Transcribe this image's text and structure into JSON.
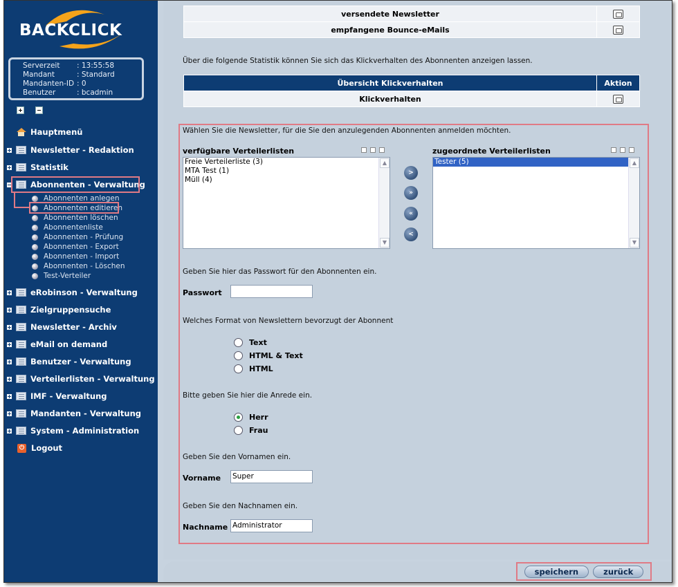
{
  "logo_text": "BACKCLICK",
  "info": [
    {
      "key": "Serverzeit",
      "value": ": 13:55:58"
    },
    {
      "key": "Mandant",
      "value": ": Standard"
    },
    {
      "key": "Mandanten-ID",
      "value": ": 0"
    },
    {
      "key": "Benutzer",
      "value": ": bcadmin"
    }
  ],
  "nav": {
    "hauptmenu": "Hauptmenü",
    "newsletter_redaktion": "Newsletter - Redaktion",
    "statistik": "Statistik",
    "abonnenten_verwaltung": "Abonnenten - Verwaltung",
    "sub": [
      "Abonnenten anlegen",
      "Abonnenten editieren",
      "Abonnenten löschen",
      "Abonnentenliste",
      "Abonnenten - Prüfung",
      "Abonnenten - Export",
      "Abonnenten - Import",
      "Abonnenten - Löschen",
      "Test-Verteiler"
    ],
    "erobinson": "eRobinson - Verwaltung",
    "zielgruppensuche": "Zielgruppensuche",
    "newsletter_archiv": "Newsletter - Archiv",
    "email_on_demand": "eMail on demand",
    "benutzer": "Benutzer - Verwaltung",
    "verteilerlisten": "Verteilerlisten - Verwaltung",
    "imf": "IMF - Verwaltung",
    "mandanten": "Mandanten - Verwaltung",
    "system": "System - Administration",
    "logout": "Logout"
  },
  "top_table": {
    "row1": "versendete Newsletter",
    "row2": "empfangene Bounce-eMails"
  },
  "stat_intro": "Über die folgende Statistik können Sie sich das Klickverhalten des Abonnenten anzeigen lassen.",
  "click_table": {
    "head_title": "Übersicht Klickverhalten",
    "head_action": "Aktion",
    "row": "Klickverhalten"
  },
  "form": {
    "intro": "Wählen Sie die Newsletter, für die Sie den anzulegenden Abonnenten anmelden möchten.",
    "available_title": "verfügbare Verteilerlisten",
    "available_items": [
      "Freie Verteilerliste (3)",
      "MTA Test (1)",
      "Müll (4)"
    ],
    "assigned_title": "zugeordnete Verteilerlisten",
    "assigned_items": [
      "Tester (5)"
    ],
    "move_buttons": [
      ">",
      "»",
      "«",
      "<"
    ],
    "password_prompt": "Geben Sie hier das Passwort für den Abonnenten ein.",
    "password_label": "Passwort",
    "password_value": "",
    "format_prompt": "Welches Format von Newslettern bevorzugt der Abonnent",
    "format_options": [
      "Text",
      "HTML & Text",
      "HTML"
    ],
    "salutation_prompt": "Bitte geben Sie hier die Anrede ein.",
    "salutation_options": [
      "Herr",
      "Frau"
    ],
    "salutation_selected": "Herr",
    "firstname_prompt": "Geben Sie den Vornamen ein.",
    "firstname_label": "Vorname",
    "firstname_value": "Super",
    "lastname_prompt": "Geben Sie den Nachnamen ein.",
    "lastname_label": "Nachname",
    "lastname_value": "Administrator"
  },
  "buttons": {
    "save": "speichern",
    "back": "zurück"
  },
  "colors": {
    "sidebar": "#0d3c73",
    "highlight": "#e07a85",
    "selected": "#3163c5"
  }
}
